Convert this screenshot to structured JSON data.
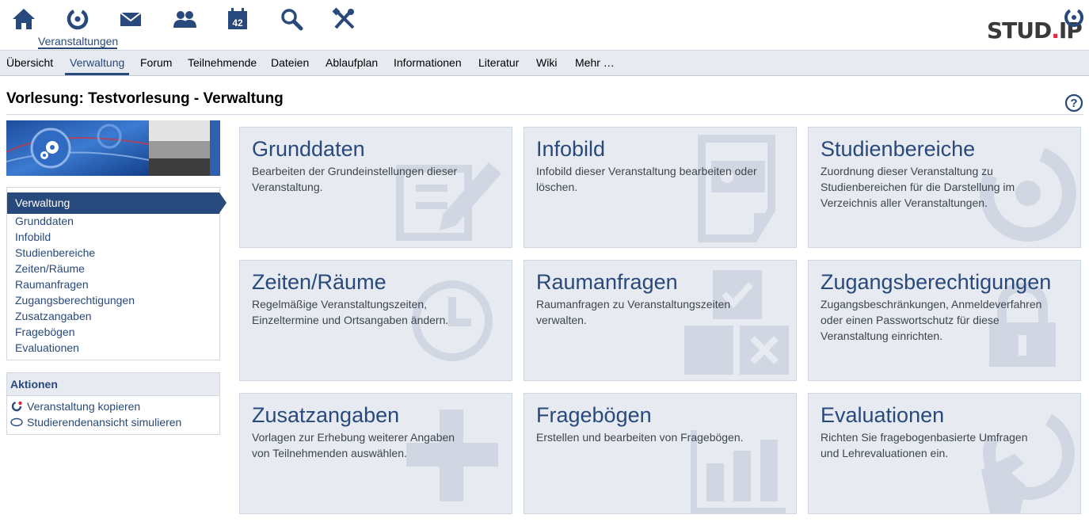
{
  "header": {
    "active_label": "Veranstaltungen",
    "calendar_day": "42",
    "icons": [
      "home-icon",
      "courses-icon",
      "mail-icon",
      "community-icon",
      "calendar-icon",
      "search-icon",
      "tools-icon"
    ],
    "logo": {
      "text_main": "STUD",
      "text_dot": ".",
      "text_end": "IP"
    }
  },
  "tabs": [
    {
      "label": "Übersicht"
    },
    {
      "label": "Verwaltung",
      "active": true
    },
    {
      "label": "Forum"
    },
    {
      "label": "Teilnehmende"
    },
    {
      "label": "Dateien"
    },
    {
      "label": "Ablaufplan"
    },
    {
      "label": "Informationen"
    },
    {
      "label": "Literatur"
    },
    {
      "label": "Wiki"
    },
    {
      "label": "Mehr …"
    }
  ],
  "page": {
    "title": "Vorlesung: Testvorlesung - Verwaltung"
  },
  "sidebar": {
    "nav_header": "Verwaltung",
    "nav_items": [
      {
        "label": "Grunddaten"
      },
      {
        "label": "Infobild"
      },
      {
        "label": "Studienbereiche"
      },
      {
        "label": "Zeiten/Räume"
      },
      {
        "label": "Raumanfragen"
      },
      {
        "label": "Zugangsberechtigungen"
      },
      {
        "label": "Zusatzangaben"
      },
      {
        "label": "Fragebögen"
      },
      {
        "label": "Evaluationen"
      }
    ],
    "actions_header": "Aktionen",
    "actions": [
      {
        "label": "Veranstaltung kopieren",
        "icon": "copy-icon"
      },
      {
        "label": "Studierendenansicht simulieren",
        "icon": "eye-icon"
      }
    ]
  },
  "tiles": [
    {
      "title": "Grunddaten",
      "desc": "Bearbeiten der Grundeinstellungen dieser Veranstaltung.",
      "icon": "edit-icon"
    },
    {
      "title": "Infobild",
      "desc": "Infobild dieser Veranstaltung bearbeiten oder löschen.",
      "icon": "image-file-icon"
    },
    {
      "title": "Studienbereiche",
      "desc": "Zuordnung dieser Veranstaltung zu Studienbereichen für die Darstellung im Verzeichnis aller Veranstaltungen.",
      "icon": "seminar-icon"
    },
    {
      "title": "Zeiten/Räume",
      "desc": "Regelmäßige Veranstaltungszeiten, Einzeltermine und Ortsangaben ändern.",
      "icon": "clock-icon"
    },
    {
      "title": "Raumanfragen",
      "desc": "Raumanfragen zu Veranstaltungszeiten verwalten.",
      "icon": "room-request-icon"
    },
    {
      "title": "Zugangsberechtigungen",
      "desc": "Zugangsbeschränkungen, Anmeldeverfahren oder einen Passwortschutz für diese Veranstaltung einrichten.",
      "icon": "lock-icon"
    },
    {
      "title": "Zusatzangaben",
      "desc": "Vorlagen zur Erhebung weiterer Angaben von Teilnehmenden auswählen.",
      "icon": "plus-icon"
    },
    {
      "title": "Fragebögen",
      "desc": "Erstellen und bearbeiten von Fragebögen.",
      "icon": "bar-chart-icon"
    },
    {
      "title": "Evaluationen",
      "desc": "Richten Sie fragebogenbasierte Umfragen und Lehrevaluationen ein.",
      "icon": "evaluation-icon"
    }
  ]
}
